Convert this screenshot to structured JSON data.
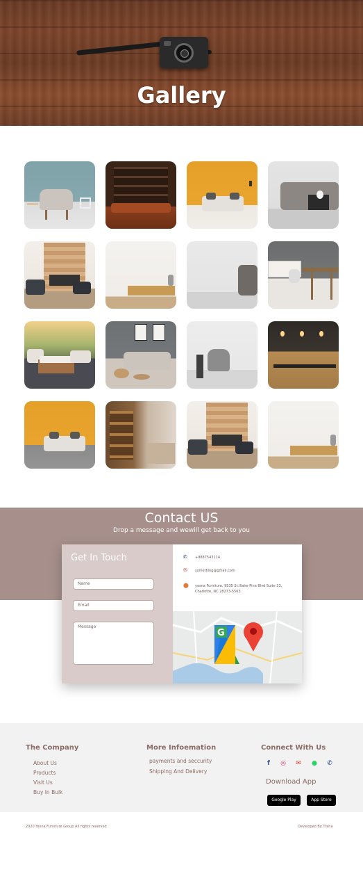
{
  "hero": {
    "title": "Gallery"
  },
  "gallery": {
    "tiles": [
      {
        "name": "armchair-teal-wall"
      },
      {
        "name": "bookshelf-leather-sofa"
      },
      {
        "name": "yellow-wall-sofa"
      },
      {
        "name": "grey-sofa-white-wall"
      },
      {
        "name": "fireplace-living-room"
      },
      {
        "name": "white-wall-sideboard"
      },
      {
        "name": "grey-armchair"
      },
      {
        "name": "dining-area-grey-wall"
      },
      {
        "name": "outdoor-patio-sunset"
      },
      {
        "name": "sofa-framed-art"
      },
      {
        "name": "armchair-blanket"
      },
      {
        "name": "kitchen-bar-stools"
      },
      {
        "name": "yellow-wall-sofa-2"
      },
      {
        "name": "furniture-store-shelves"
      },
      {
        "name": "fireplace-living-room-2"
      },
      {
        "name": "white-wall-sideboard-2"
      }
    ]
  },
  "contact": {
    "title": "Contact US",
    "subtitle": "Drop a message and wewill  get back to you",
    "form": {
      "heading": "Get In Touch",
      "name_placeholder": "Name",
      "email_placeholder": "Email",
      "message_placeholder": "Message"
    },
    "info": {
      "phone": "+9887543114",
      "email": "something@gmail.com",
      "address_line1": "yasna Furniture, 9535 St.Illahe Pine Blvd Suite 33,",
      "address_line2": "Charlotte, NC 28273-5563"
    }
  },
  "footer": {
    "company": {
      "heading": "The Company",
      "links": [
        "About Us",
        "Products",
        "Visit Us",
        "Buy In Bulk"
      ]
    },
    "more": {
      "heading": "More Infoemation",
      "links": [
        "payments and seccurity",
        "Shipping And Delivery"
      ]
    },
    "connect": {
      "heading": "Connect With   Us",
      "icons": [
        "facebook-icon",
        "instagram-icon",
        "gmail-icon",
        "whatsapp-icon",
        "phone-icon"
      ],
      "download_heading": "Download App",
      "google_play": "Google Play",
      "app_store": "App Store"
    },
    "copyright": "2020 Yasna Furniture Group All rights reserved",
    "developer": "Developed By Tfaha"
  }
}
